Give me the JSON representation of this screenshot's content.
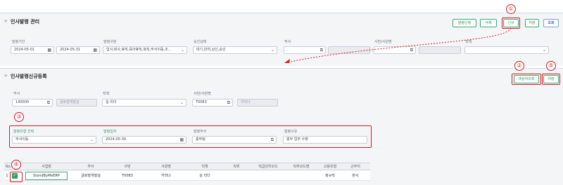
{
  "top": {
    "title": "인사발령 관리",
    "buttons": {
      "apply": "발령신청",
      "delete": "삭제",
      "new": "신규",
      "save": "저장",
      "search": "조회"
    },
    "filters": {
      "period_label": "발령기간",
      "date_from": "2024-05-01",
      "date_to": "2024-05-31",
      "type_label": "발령구분",
      "type_value": "입사,퇴사,휴직,육아휴직,복직,부서이동,조...",
      "status_label": "승인상태",
      "status_value": "대기,반려,상신,승인",
      "dept_label": "부서",
      "emp_label": "사번/사원명",
      "position_label": "직책"
    }
  },
  "bottom": {
    "title": "인사발령신규등록",
    "buttons": {
      "select_target": "대상자조회",
      "save": "저장"
    },
    "fields": {
      "dept_label": "부서",
      "dept_code": "140000",
      "dept_name": "글로벌개발실",
      "position_label": "직책",
      "position_value": "실 리더",
      "emp_label": "사번/사원명",
      "emp_code": "T0083",
      "emp_name": "카리나"
    },
    "appoint": {
      "type_label": "발령유형 선택",
      "type_value": "부서이동",
      "date_label": "발령일자",
      "date_value": "2024-05-30",
      "dept_label": "발령부서",
      "dept_value": "총무팀",
      "reason_label": "발령사유",
      "reason_value": "총무 업무 수행"
    },
    "grid": {
      "headers": [
        "No.",
        "사업장",
        "부서",
        "사번",
        "사원명",
        "직책",
        "직위",
        "직급년차코드",
        "직무코드명",
        "고용유형",
        "근무지"
      ],
      "rows": [
        {
          "no": "1",
          "site": "StandByMeERP",
          "dept": "글로벌개발실",
          "code": "T0083",
          "name": "카리나",
          "position": "실 리더",
          "rank": "",
          "grade": "",
          "job": "",
          "employ": "정규직",
          "place": "본사"
        }
      ]
    }
  },
  "markers": [
    "①",
    "②",
    "③",
    "④",
    "⑤"
  ],
  "icons": [
    "star-icon",
    "calendar-icon",
    "chevron-down-icon",
    "link-icon",
    "checkbox-icon"
  ],
  "colors": {
    "accent_green": "#2fa067",
    "marker_red": "#d71920",
    "search_blue": "#2b66c3"
  }
}
